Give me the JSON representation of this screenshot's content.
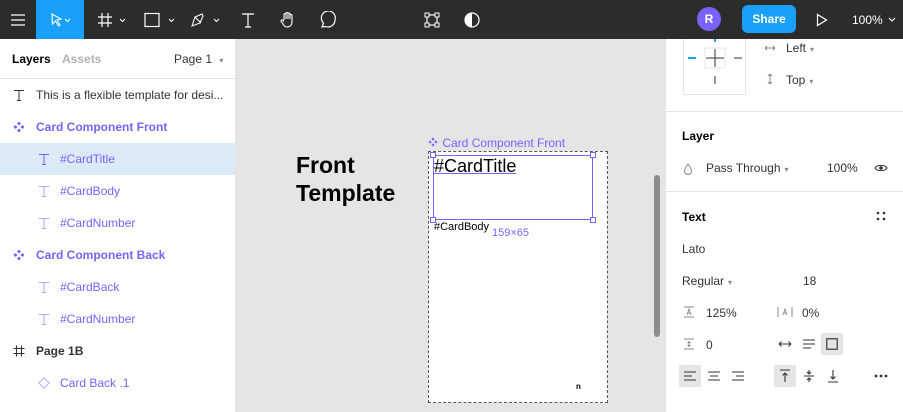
{
  "toolbar": {
    "avatar_initial": "R",
    "share_label": "Share",
    "zoom": "100%"
  },
  "left_panel": {
    "tabs": {
      "layers": "Layers",
      "assets": "Assets"
    },
    "page_selector": "Page 1",
    "layers": [
      {
        "label": "This is a flexible template for desi...",
        "type": "text",
        "style": "normal"
      },
      {
        "label": "Card Component Front",
        "type": "component",
        "style": "component"
      },
      {
        "label": "#CardTitle",
        "type": "text",
        "style": "child-selected"
      },
      {
        "label": "#CardBody",
        "type": "text",
        "style": "child"
      },
      {
        "label": "#CardNumber",
        "type": "text",
        "style": "child"
      },
      {
        "label": "Card Component Back",
        "type": "component",
        "style": "component"
      },
      {
        "label": "#CardBack",
        "type": "text",
        "style": "child"
      },
      {
        "label": "#CardNumber",
        "type": "text",
        "style": "child"
      },
      {
        "label": "Page 1B",
        "type": "frame",
        "style": "frame"
      },
      {
        "label": "Card Back .1",
        "type": "instance",
        "style": "instance"
      }
    ]
  },
  "canvas": {
    "frame_title": "Front Template",
    "component_label": "Card Component Front",
    "card_title": "#CardTitle",
    "card_body": "#CardBody",
    "dimensions": "159×65",
    "card_number": "n"
  },
  "right_panel": {
    "constraints": {
      "horizontal": "Left",
      "vertical": "Top"
    },
    "layer": {
      "heading": "Layer",
      "blend_mode": "Pass Through",
      "opacity": "100%"
    },
    "text": {
      "heading": "Text",
      "font_family": "Lato",
      "font_style": "Regular",
      "font_size": "18",
      "line_height": "125%",
      "letter_spacing": "0%",
      "paragraph_spacing": "0"
    }
  },
  "colors": {
    "toolbar_bg": "#2c2c2c",
    "accent_blue": "#18a0fb",
    "component_purple": "#7b61ff",
    "selection_bg": "#daebf7"
  }
}
